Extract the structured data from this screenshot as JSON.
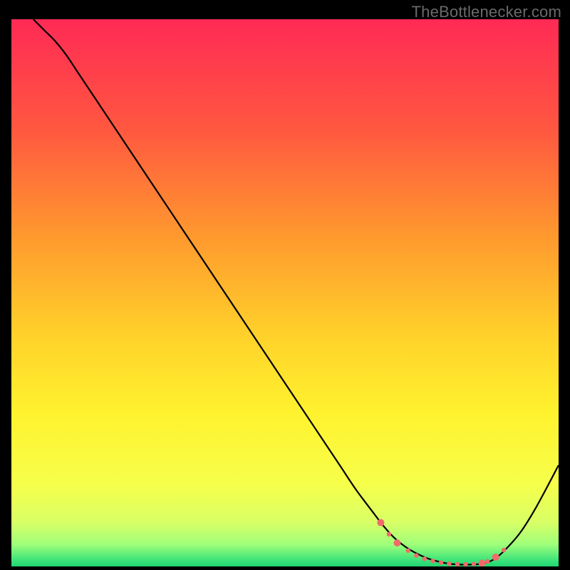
{
  "watermark": "TheBottlenecker.com",
  "chart_data": {
    "type": "line",
    "title": "",
    "xlabel": "",
    "ylabel": "",
    "xlim": [
      0,
      100
    ],
    "ylim": [
      0,
      100
    ],
    "background_gradient": {
      "stops": [
        {
          "offset": 0,
          "color": "#ff2a55"
        },
        {
          "offset": 20,
          "color": "#ff5740"
        },
        {
          "offset": 40,
          "color": "#ff9a2e"
        },
        {
          "offset": 58,
          "color": "#ffd22a"
        },
        {
          "offset": 72,
          "color": "#fff22e"
        },
        {
          "offset": 85,
          "color": "#f6ff4a"
        },
        {
          "offset": 92,
          "color": "#d8ff66"
        },
        {
          "offset": 96,
          "color": "#9fff7a"
        },
        {
          "offset": 99,
          "color": "#38e27a"
        },
        {
          "offset": 100,
          "color": "#1fd66f"
        }
      ]
    },
    "series": [
      {
        "name": "bottleneck-curve",
        "color": "#000000",
        "width": 2.2,
        "x": [
          4,
          6,
          8,
          10,
          12,
          15,
          20,
          25,
          30,
          35,
          40,
          45,
          50,
          55,
          60,
          63,
          66,
          68,
          70,
          72,
          74,
          76,
          78,
          80,
          82,
          84,
          86,
          88,
          90,
          93,
          96,
          100
        ],
        "y": [
          100,
          98,
          96,
          93.5,
          90.5,
          86,
          78.5,
          71,
          63.5,
          56,
          48.5,
          41,
          33.5,
          26,
          18.5,
          14,
          10,
          7.4,
          5.2,
          3.6,
          2.4,
          1.5,
          0.9,
          0.5,
          0.35,
          0.35,
          0.5,
          1.2,
          2.8,
          6.2,
          11,
          18.5
        ]
      }
    ],
    "markers": {
      "name": "highlighted-range",
      "color": "#f16a6a",
      "radius_small": 3.2,
      "radius_large": 5.0,
      "points": [
        {
          "x": 67.5,
          "y": 8.0,
          "r": "large"
        },
        {
          "x": 69.0,
          "y": 5.9,
          "r": "small"
        },
        {
          "x": 70.5,
          "y": 4.3,
          "r": "large"
        },
        {
          "x": 72.5,
          "y": 2.9,
          "r": "small"
        },
        {
          "x": 74.0,
          "y": 2.0,
          "r": "small"
        },
        {
          "x": 75.5,
          "y": 1.4,
          "r": "small"
        },
        {
          "x": 77.0,
          "y": 1.0,
          "r": "small"
        },
        {
          "x": 78.5,
          "y": 0.7,
          "r": "small"
        },
        {
          "x": 80.0,
          "y": 0.5,
          "r": "small"
        },
        {
          "x": 81.5,
          "y": 0.4,
          "r": "small"
        },
        {
          "x": 83.0,
          "y": 0.4,
          "r": "small"
        },
        {
          "x": 84.5,
          "y": 0.45,
          "r": "small"
        },
        {
          "x": 86.0,
          "y": 0.6,
          "r": "large"
        },
        {
          "x": 87.0,
          "y": 0.9,
          "r": "small"
        },
        {
          "x": 88.5,
          "y": 1.7,
          "r": "large"
        },
        {
          "x": 90.0,
          "y": 3.0,
          "r": "small"
        }
      ]
    }
  }
}
